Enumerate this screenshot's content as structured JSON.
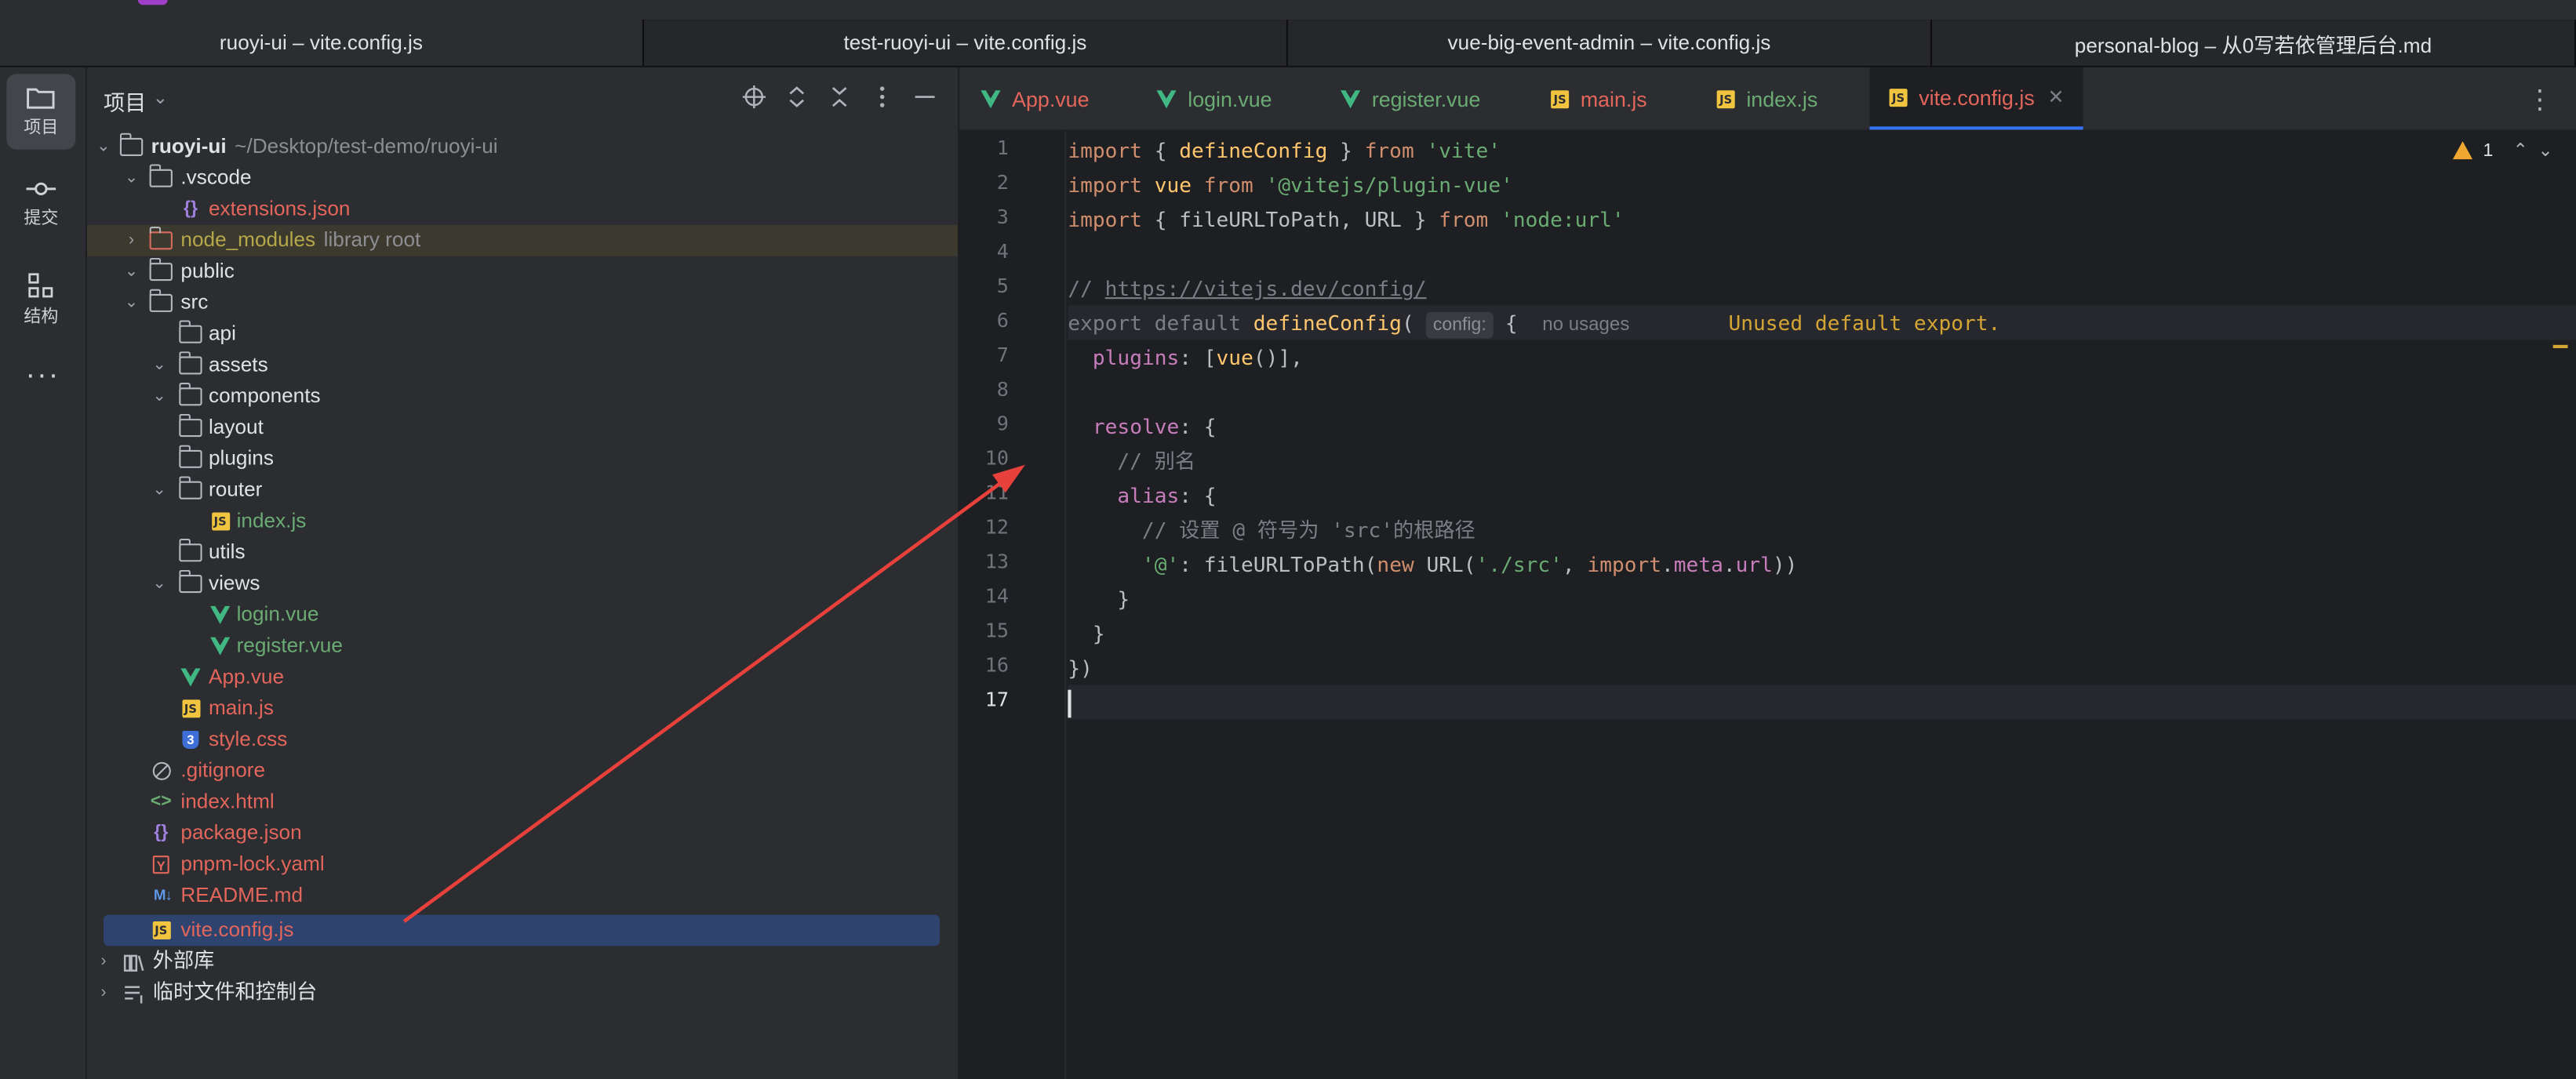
{
  "window_tabs": [
    "ruoyi-ui – vite.config.js",
    "test-ruoyi-ui – vite.config.js",
    "vue-big-event-admin – vite.config.js",
    "personal-blog – 从0写若依管理后台.md"
  ],
  "activity": {
    "project_label": "项目",
    "commit_label": "提交",
    "structure_label": "结构",
    "more": "···"
  },
  "project_panel": {
    "title": "项目",
    "tree": [
      {
        "name": "ruoyi-ui",
        "hint": "~/Desktop/test-demo/ruoyi-ui",
        "icon": "folder-icon"
      },
      {
        "name": ".vscode",
        "icon": "folder-icon"
      },
      {
        "name": "extensions.json",
        "icon": "json-icon"
      },
      {
        "name": "node_modules",
        "hint": "library root",
        "icon": "folder-icon"
      },
      {
        "name": "public",
        "icon": "folder-icon"
      },
      {
        "name": "src",
        "icon": "folder-icon"
      },
      {
        "name": "api",
        "icon": "folder-icon"
      },
      {
        "name": "assets",
        "icon": "folder-icon"
      },
      {
        "name": "components",
        "icon": "folder-icon"
      },
      {
        "name": "layout",
        "icon": "folder-icon"
      },
      {
        "name": "plugins",
        "icon": "folder-icon"
      },
      {
        "name": "router",
        "icon": "folder-icon"
      },
      {
        "name": "index.js",
        "icon": "js-icon"
      },
      {
        "name": "utils",
        "icon": "folder-icon"
      },
      {
        "name": "views",
        "icon": "folder-icon"
      },
      {
        "name": "login.vue",
        "icon": "vue-icon"
      },
      {
        "name": "register.vue",
        "icon": "vue-icon"
      },
      {
        "name": "App.vue",
        "icon": "vue-icon"
      },
      {
        "name": "main.js",
        "icon": "js-icon"
      },
      {
        "name": "style.css",
        "icon": "css-icon"
      },
      {
        "name": ".gitignore",
        "icon": "ignore-icon"
      },
      {
        "name": "index.html",
        "icon": "html-icon"
      },
      {
        "name": "package.json",
        "icon": "json-icon"
      },
      {
        "name": "pnpm-lock.yaml",
        "icon": "yaml-icon"
      },
      {
        "name": "README.md",
        "icon": "markdown-icon"
      },
      {
        "name": "vite.config.js",
        "icon": "js-icon"
      },
      {
        "name": "外部库",
        "icon": "library-icon"
      },
      {
        "name": "临时文件和控制台",
        "icon": "scratches-icon"
      }
    ]
  },
  "editor": {
    "tabs": [
      {
        "label": "App.vue",
        "icon": "vue-icon",
        "color": "#e3665c"
      },
      {
        "label": "login.vue",
        "icon": "vue-icon",
        "color": "#6aab73"
      },
      {
        "label": "register.vue",
        "icon": "vue-icon",
        "color": "#6aab73"
      },
      {
        "label": "main.js",
        "icon": "js-icon",
        "color": "#e3665c"
      },
      {
        "label": "index.js",
        "icon": "js-icon",
        "color": "#6aab73"
      },
      {
        "label": "vite.config.js",
        "icon": "js-icon",
        "color": "#e3665c",
        "active": true
      }
    ],
    "line_numbers": [
      "1",
      "2",
      "3",
      "4",
      "5",
      "6",
      "7",
      "8",
      "9",
      "10",
      "11",
      "12",
      "13",
      "14",
      "15",
      "16",
      "17"
    ],
    "current_line": "17",
    "inlay_hint": "config:",
    "usage_hint": "no usages",
    "warning_message": "Unused default export.",
    "warning_count": "1",
    "code_lines": [
      "import { defineConfig } from 'vite'",
      "import vue from '@vitejs/plugin-vue'",
      "import { fileURLToPath, URL } from 'node:url'",
      "",
      "// https://vitejs.dev/config/",
      "export default defineConfig( {",
      "  plugins: [vue()],",
      "",
      "  resolve: {",
      "    // 别名",
      "    alias: {",
      "      // 设置 @ 符号为 'src'的根路径",
      "      '@': fileURLToPath(new URL('./src', import.meta.url))",
      "    }",
      "  }",
      "})",
      ""
    ]
  },
  "colors": {
    "accent": "#3574f0",
    "annotation_arrow": "#e8413c",
    "modified_file": "#e3665c",
    "new_file": "#6aab73"
  }
}
